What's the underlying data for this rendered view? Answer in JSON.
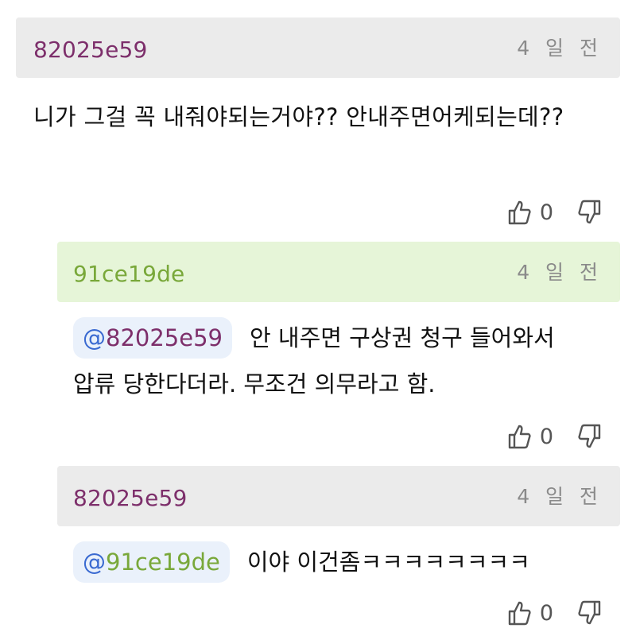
{
  "comments": [
    {
      "username": "82025e59",
      "time": "4 일 전",
      "text": "니가 그걸 꼭 내줘야되는거야?? 안내주면어케되는데??",
      "likes": "0"
    },
    {
      "username": "91ce19de",
      "time": "4 일 전",
      "mention": "82025e59",
      "text": "안 내주면 구상권 청구 들어와서 압류 당한다더라. 무조건 의무라고 함.",
      "likes": "0"
    },
    {
      "username": "82025e59",
      "time": "4 일 전",
      "mention": "91ce19de",
      "text": "이야 이건좀ㅋㅋㅋㅋㅋㅋㅋㅋ",
      "likes": "0"
    }
  ],
  "mention_prefix": "@",
  "colors": {
    "purple_user": "#7d2f6b",
    "green_user": "#79a83a",
    "mention_at": "#3a6ad1",
    "header_gray": "#ebebeb",
    "header_green": "#e6f5d8"
  },
  "icons": [
    "thumbs-up-icon",
    "thumbs-down-icon"
  ]
}
